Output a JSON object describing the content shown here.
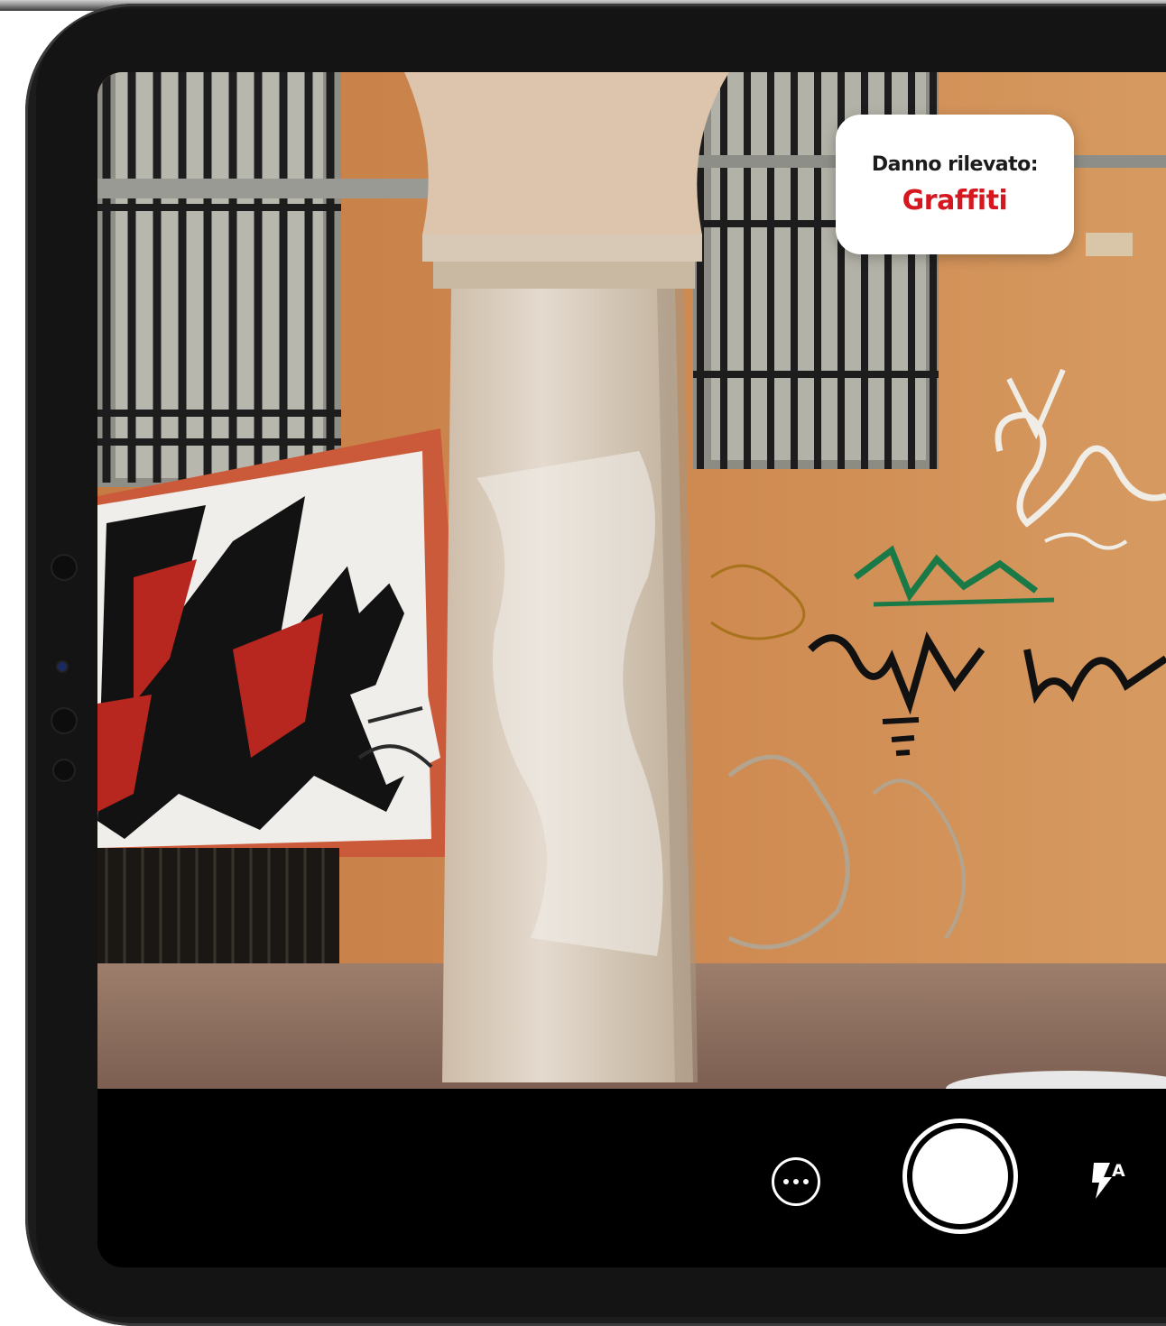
{
  "detection": {
    "label": "Danno rilevato:",
    "value": "Graffiti",
    "value_color": "#d5171f"
  },
  "camera": {
    "more_icon": "ellipsis-circle-icon",
    "shutter_icon": "shutter-icon",
    "flash_icon": "flash-auto-icon",
    "flash_mode": "A"
  }
}
